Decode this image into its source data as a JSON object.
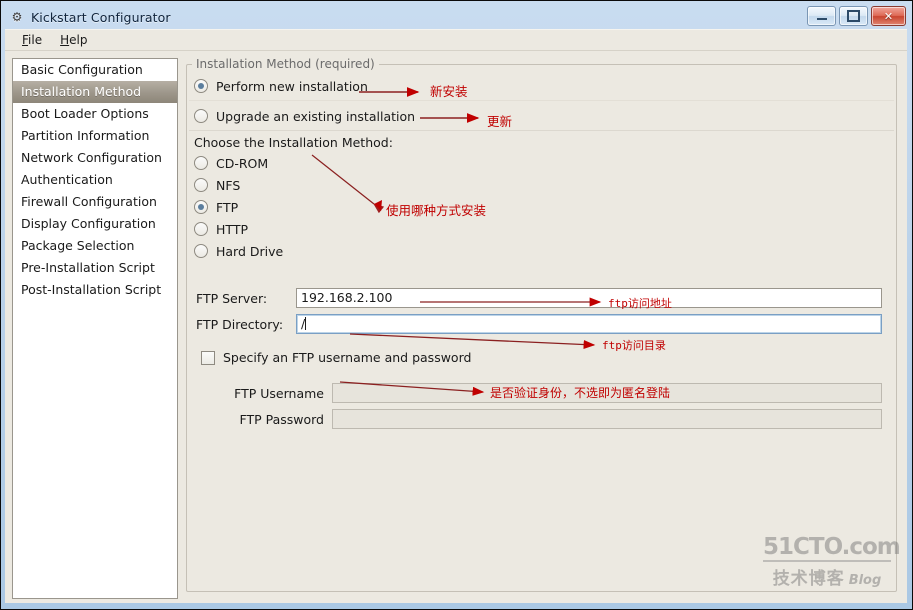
{
  "window": {
    "title": "Kickstart Configurator",
    "icon": "app-icon",
    "buttons": {
      "minimize": "minimize-button",
      "maximize": "maximize-button",
      "close": "✕"
    }
  },
  "menubar": {
    "items": [
      {
        "label": "File",
        "accel": "F",
        "rest": "ile"
      },
      {
        "label": "Help",
        "accel": "H",
        "rest": "elp"
      }
    ]
  },
  "sidebar": {
    "items": [
      {
        "label": "Basic Configuration",
        "selected": false
      },
      {
        "label": "Installation Method",
        "selected": true
      },
      {
        "label": "Boot Loader Options",
        "selected": false
      },
      {
        "label": "Partition Information",
        "selected": false
      },
      {
        "label": "Network Configuration",
        "selected": false
      },
      {
        "label": "Authentication",
        "selected": false
      },
      {
        "label": "Firewall Configuration",
        "selected": false
      },
      {
        "label": "Display Configuration",
        "selected": false
      },
      {
        "label": "Package Selection",
        "selected": false
      },
      {
        "label": "Pre-Installation Script",
        "selected": false
      },
      {
        "label": "Post-Installation Script",
        "selected": false
      }
    ]
  },
  "main": {
    "group_legend": "Installation Method (required)",
    "install_action": {
      "options": [
        {
          "label": "Perform new installation",
          "selected": true
        },
        {
          "label": "Upgrade an existing installation",
          "selected": false
        }
      ]
    },
    "method_label": "Choose the Installation Method:",
    "method_options": [
      {
        "label": "CD-ROM",
        "selected": false
      },
      {
        "label": "NFS",
        "selected": false
      },
      {
        "label": "FTP",
        "selected": true
      },
      {
        "label": "HTTP",
        "selected": false
      },
      {
        "label": "Hard Drive",
        "selected": false
      }
    ],
    "ftp_server": {
      "label": "FTP Server:",
      "value": "192.168.2.100",
      "focused": false
    },
    "ftp_directory": {
      "label": "FTP Directory:",
      "value": "/",
      "focused": true
    },
    "specify_credentials": {
      "label": "Specify an FTP username and password",
      "checked": false
    },
    "ftp_username": {
      "label": "FTP Username",
      "value": "",
      "disabled": true
    },
    "ftp_password": {
      "label": "FTP Password",
      "value": "",
      "disabled": true
    }
  },
  "annotations": {
    "color": "#c00000",
    "items": [
      {
        "text": "新安装",
        "meaning": "new-install-note"
      },
      {
        "text": "更新",
        "meaning": "upgrade-note"
      },
      {
        "text": "使用哪种方式安装",
        "meaning": "which-method-note"
      },
      {
        "text": "ftp访问地址",
        "meaning": "ftp-server-note"
      },
      {
        "text": "ftp访问目录",
        "meaning": "ftp-directory-note"
      },
      {
        "text": "是否验证身份，不选即为匿名登陆",
        "meaning": "credentials-note"
      }
    ]
  },
  "watermark": {
    "top": "51CTO.com",
    "bottom_cn": "技术博客",
    "bottom_en": "Blog"
  }
}
